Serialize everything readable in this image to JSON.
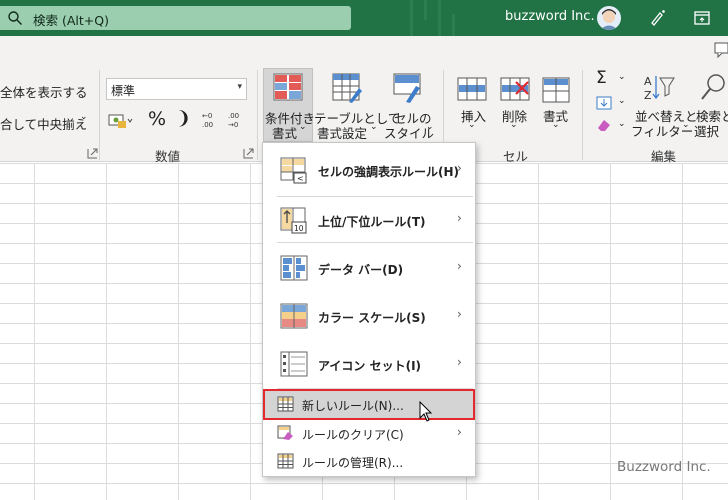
{
  "titlebar": {
    "search_text": "検索 (Alt+Q)",
    "user_name": "buzzword Inc.",
    "accent": "#217346"
  },
  "ribbon": {
    "alignment_group": {
      "wrap_label": "全体を表示する",
      "merge_label": "合して中央揃え"
    },
    "number_group": {
      "format_value": "標準",
      "percent_label": "%",
      "comma_label": "❩",
      "label": "数値"
    },
    "styles_group": {
      "conditional_line1": "条件付き",
      "conditional_line2": "書式",
      "table_line1": "テーブルとして",
      "table_line2": "書式設定",
      "cell_style_line1": "セルの",
      "cell_style_line2": "スタイル"
    },
    "cells_group": {
      "insert_label": "挿入",
      "delete_label": "削除",
      "format_label": "書式",
      "label": "セル"
    },
    "edit_group": {
      "sort_line1": "並べ替えと",
      "sort_line2": "フィルター",
      "find_line1": "検索と",
      "find_line2": "選択",
      "label": "編集"
    }
  },
  "menu": {
    "items": [
      {
        "label": "セルの強調表示ルール(H)",
        "icon": "highlight-rules-icon"
      },
      {
        "label": "上位/下位ルール(T)",
        "icon": "top-bottom-rules-icon"
      },
      {
        "label": "データ バー(D)",
        "icon": "data-bars-icon"
      },
      {
        "label": "カラー スケール(S)",
        "icon": "color-scales-icon"
      },
      {
        "label": "アイコン セット(I)",
        "icon": "icon-sets-icon"
      },
      {
        "label": "新しいルール(N)...",
        "icon": "new-rule-icon"
      },
      {
        "label": "ルールのクリア(C)",
        "icon": "clear-rules-icon"
      },
      {
        "label": "ルールの管理(R)...",
        "icon": "manage-rules-icon"
      }
    ],
    "highlight_color": "#e3282f"
  },
  "watermark": "Buzzword Inc."
}
